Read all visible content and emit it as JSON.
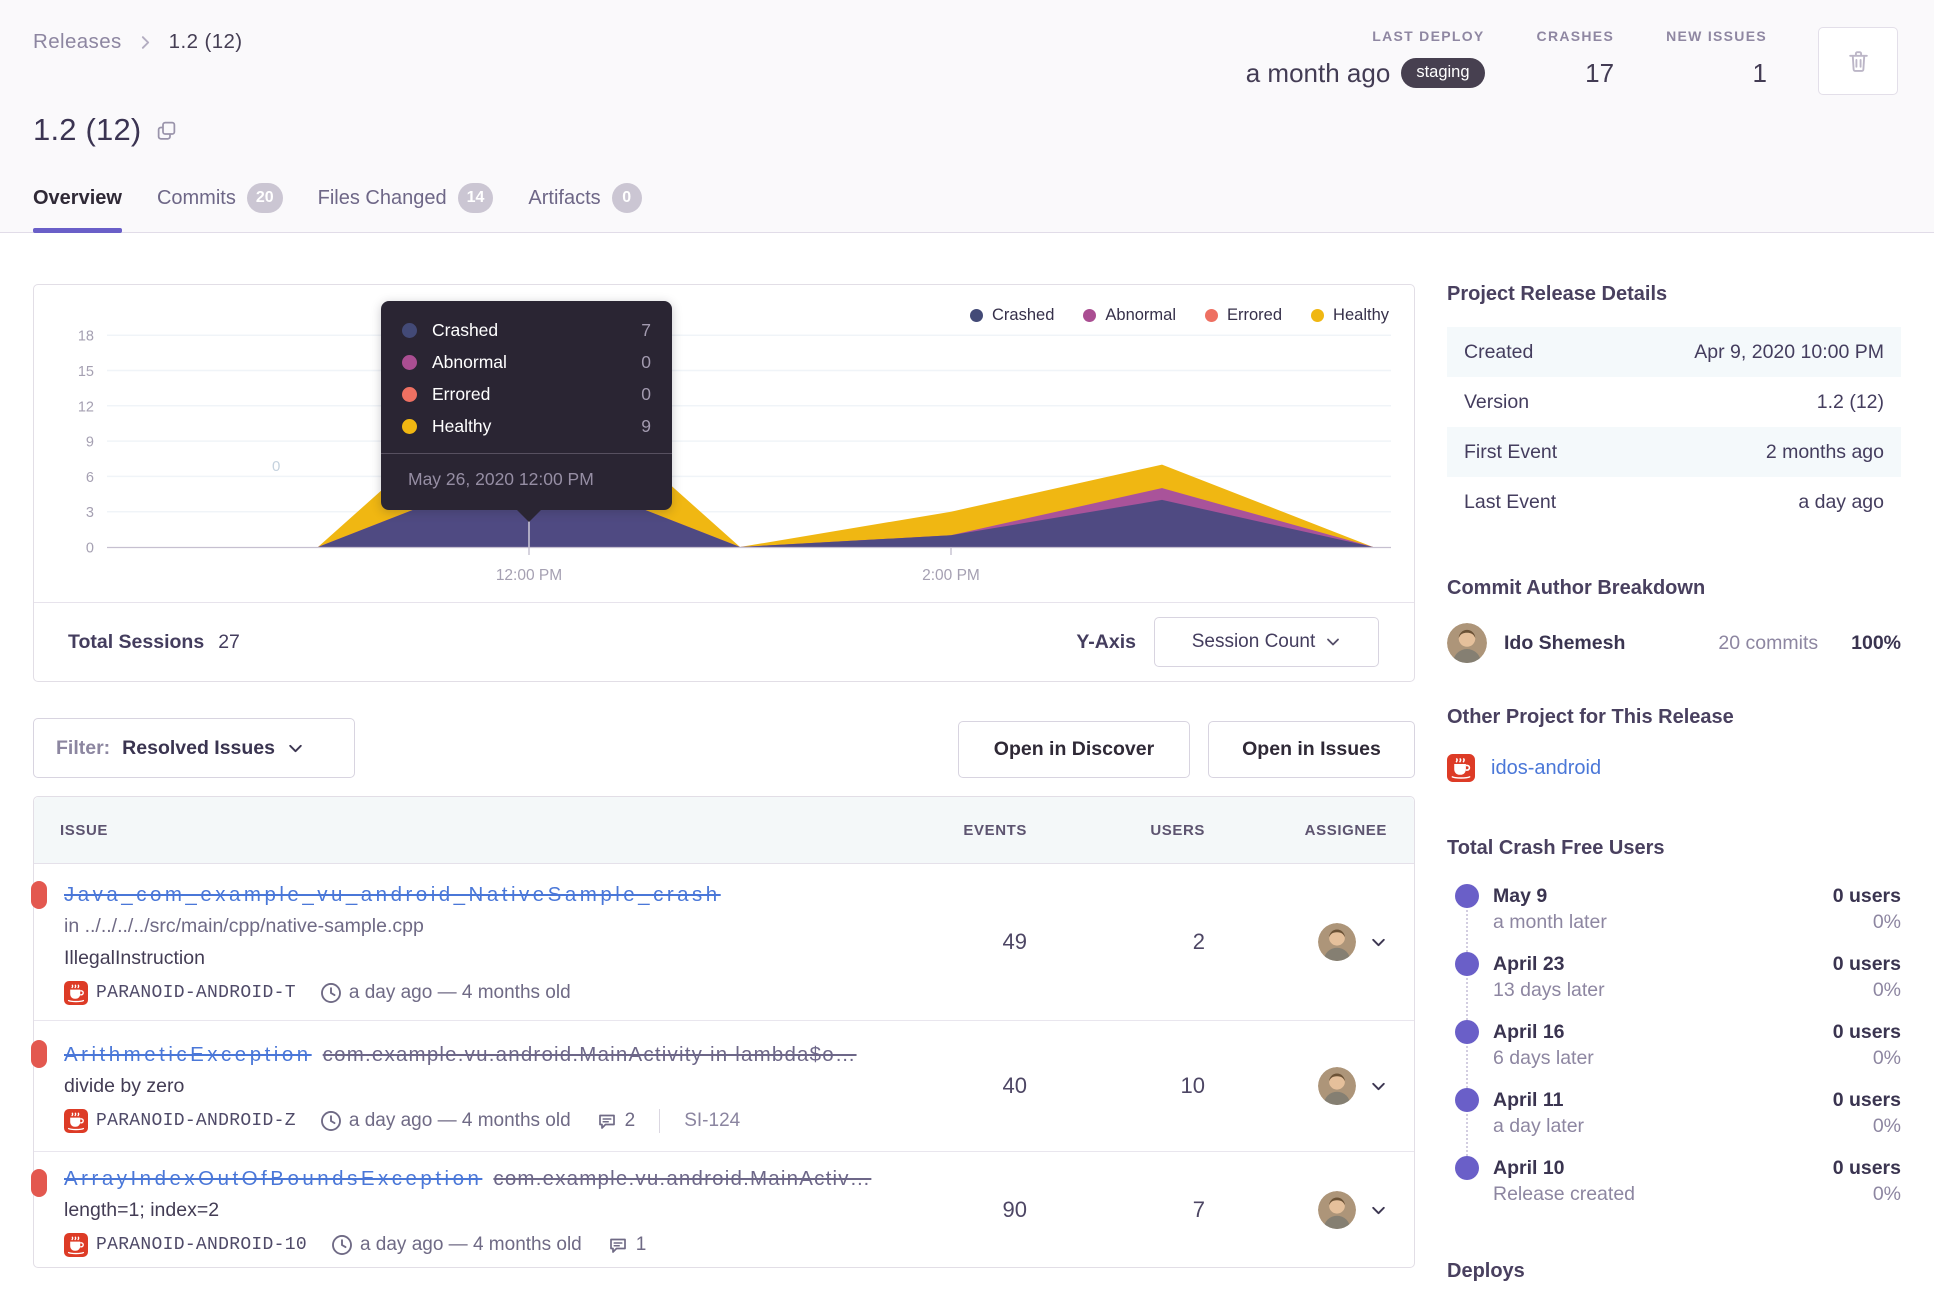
{
  "breadcrumb": {
    "parent": "Releases",
    "current": "1.2 (12)"
  },
  "header": {
    "title": "1.2 (12)",
    "stats": [
      {
        "label": "LAST DEPLOY",
        "value": "a month ago",
        "badge": "staging"
      },
      {
        "label": "CRASHES",
        "value": "17",
        "badge": ""
      },
      {
        "label": "NEW ISSUES",
        "value": "1",
        "badge": ""
      }
    ]
  },
  "tabs": [
    {
      "label": "Overview",
      "badge": "",
      "active": true
    },
    {
      "label": "Commits",
      "badge": "20",
      "active": false
    },
    {
      "label": "Files Changed",
      "badge": "14",
      "active": false
    },
    {
      "label": "Artifacts",
      "badge": "0",
      "active": false
    }
  ],
  "chart_data": {
    "type": "area",
    "stacked": true,
    "title": "Release sessions over time",
    "x": [
      "10:00 AM",
      "11:00 AM",
      "12:00 PM",
      "1:00 PM",
      "2:00 PM",
      "3:00 PM",
      "4:00 PM"
    ],
    "series": [
      {
        "name": "Crashed",
        "color": "#4f4a82",
        "dot_color": "#434a77",
        "values": [
          0,
          0,
          7,
          0,
          1,
          4,
          0
        ]
      },
      {
        "name": "Abnormal",
        "color": "#a9539a",
        "dot_color": "#aa4e92",
        "values": [
          0,
          0,
          0,
          0,
          0,
          1,
          0
        ]
      },
      {
        "name": "Errored",
        "color": "#ee7062",
        "dot_color": "#ee7062",
        "values": [
          0,
          0,
          0,
          0,
          0,
          0,
          0
        ]
      },
      {
        "name": "Healthy",
        "color": "#f0b712",
        "dot_color": "#f0b712",
        "values": [
          0,
          0,
          9,
          0,
          2,
          2,
          0
        ]
      }
    ],
    "xlabel": "",
    "ylabel": "Session Count",
    "ylim": [
      0,
      18
    ],
    "yticks": [
      0,
      3,
      6,
      9,
      12,
      15,
      18
    ],
    "xticks_shown": [
      {
        "label": "12:00 PM",
        "index": 2
      },
      {
        "label": "2:00 PM",
        "index": 4
      }
    ],
    "grid": true,
    "legend_position": "top-right",
    "faint_point_label": "0",
    "tooltip": {
      "rows": [
        {
          "name": "Crashed",
          "value": "7"
        },
        {
          "name": "Abnormal",
          "value": "0"
        },
        {
          "name": "Errored",
          "value": "0"
        },
        {
          "name": "Healthy",
          "value": "9"
        }
      ],
      "date": "May 26, 2020 12:00 PM",
      "anchor_index": 2
    }
  },
  "chart_footer": {
    "total_label": "Total Sessions",
    "total_value": "27",
    "yaxis_label": "Y-Axis",
    "yaxis_value": "Session Count"
  },
  "controls": {
    "filter_label": "Filter:",
    "filter_value": "Resolved Issues",
    "discover_label": "Open in Discover",
    "issues_label": "Open in Issues"
  },
  "issues_table": {
    "columns": {
      "issue": "Issue",
      "events": "Events",
      "users": "Users",
      "assignee": "Assignee"
    },
    "rows": [
      {
        "title": "Java_com_example_vu_android_NativeSample_crash",
        "culprit": "",
        "location": "in ../../../../src/main/cpp/native-sample.cpp",
        "message": "IllegalInstruction",
        "short_id": "PARANOID-ANDROID-T",
        "age": "a day ago — 4 months old",
        "comments": "",
        "annotation": "",
        "events": "49",
        "users": "2"
      },
      {
        "title": "ArithmeticException",
        "culprit": "com.example.vu.android.MainActivity in lambda$o…",
        "location": "",
        "message": "divide by zero",
        "short_id": "PARANOID-ANDROID-Z",
        "age": "a day ago — 4 months old",
        "comments": "2",
        "annotation": "SI-124",
        "events": "40",
        "users": "10"
      },
      {
        "title": "ArrayIndexOutOfBoundsException",
        "culprit": "com.example.vu.android.MainActiv…",
        "location": "",
        "message": "length=1; index=2",
        "short_id": "PARANOID-ANDROID-10",
        "age": "a day ago — 4 months old",
        "comments": "1",
        "annotation": "",
        "events": "90",
        "users": "7"
      }
    ]
  },
  "sidebar": {
    "details": {
      "heading": "Project Release Details",
      "rows": [
        {
          "key": "Created",
          "value": "Apr 9, 2020 10:00 PM"
        },
        {
          "key": "Version",
          "value": "1.2 (12)"
        },
        {
          "key": "First Event",
          "value": "2 months ago"
        },
        {
          "key": "Last Event",
          "value": "a day ago"
        }
      ]
    },
    "authors": {
      "heading": "Commit Author Breakdown",
      "rows": [
        {
          "name": "Ido Shemesh",
          "commits": "20 commits",
          "percent": "100%"
        }
      ]
    },
    "other_project": {
      "heading": "Other Project for This Release",
      "project": "idos-android"
    },
    "crash_free": {
      "heading": "Total Crash Free Users",
      "entries": [
        {
          "date": "May 9",
          "sub": "a month later",
          "users": "0 users",
          "percent": "0%"
        },
        {
          "date": "April 23",
          "sub": "13 days later",
          "users": "0 users",
          "percent": "0%"
        },
        {
          "date": "April 16",
          "sub": "6 days later",
          "users": "0 users",
          "percent": "0%"
        },
        {
          "date": "April 11",
          "sub": "a day later",
          "users": "0 users",
          "percent": "0%"
        },
        {
          "date": "April 10",
          "sub": "Release created",
          "users": "0 users",
          "percent": "0%"
        }
      ]
    },
    "deploys_heading": "Deploys"
  }
}
